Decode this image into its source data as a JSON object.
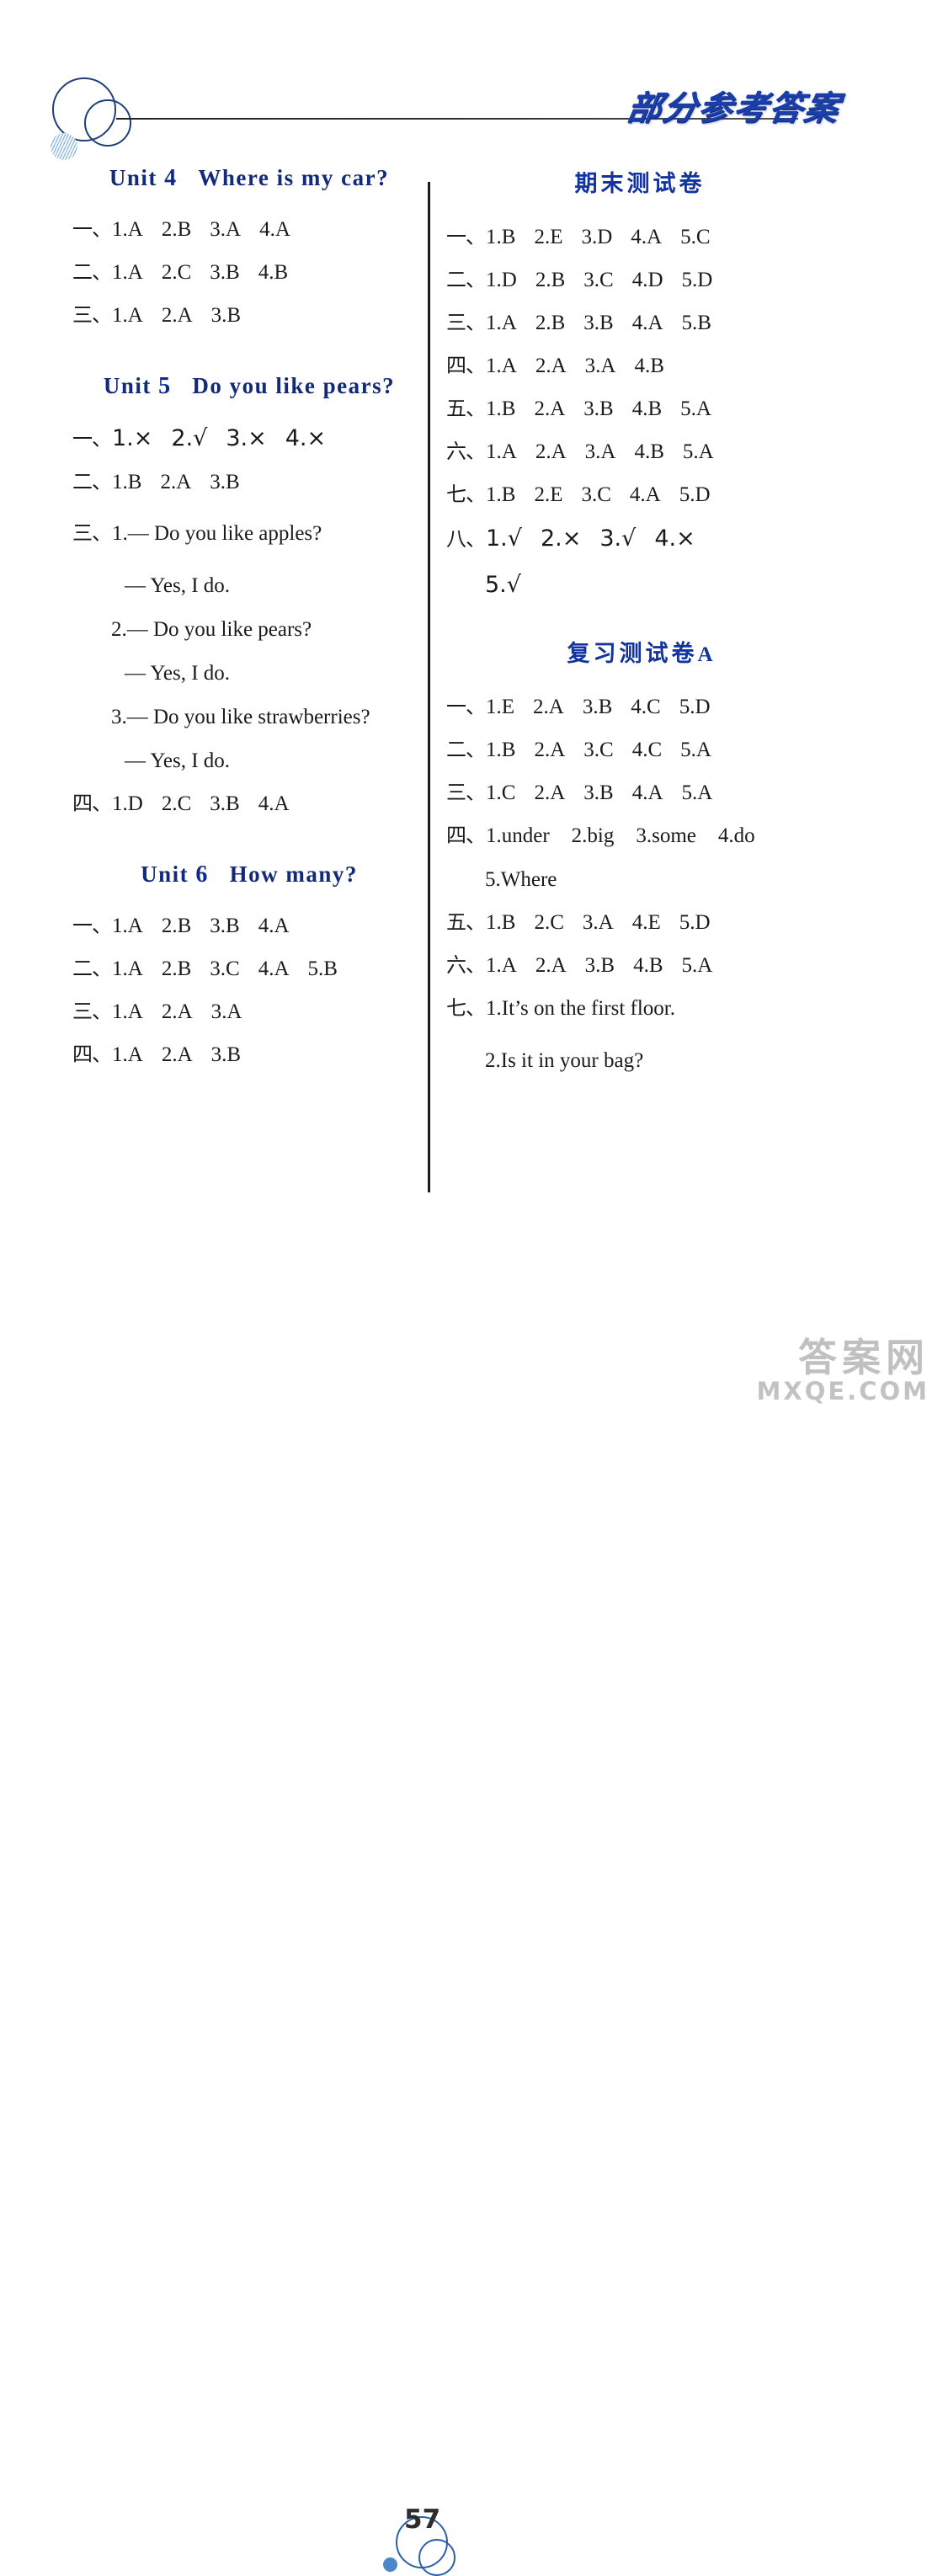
{
  "header": {
    "title": "部分参考答案"
  },
  "footer": {
    "page_number": "57",
    "watermark_cn": "答案网",
    "watermark_en": "MXQE.COM"
  },
  "left_column": {
    "unit4": {
      "label": "Unit",
      "number": "4",
      "title": "Where is my car?",
      "rows": [
        {
          "num": "一、",
          "answers": [
            "1.A",
            "2.B",
            "3.A",
            "4.A"
          ]
        },
        {
          "num": "二、",
          "answers": [
            "1.A",
            "2.C",
            "3.B",
            "4.B"
          ]
        },
        {
          "num": "三、",
          "answers": [
            "1.A",
            "2.A",
            "3.B"
          ]
        }
      ]
    },
    "unit5": {
      "label": "Unit",
      "number": "5",
      "title": "Do you like pears?",
      "rows": [
        {
          "num": "一、",
          "answers": [
            "1.×",
            "2.√",
            "3.×",
            "4.×"
          ]
        },
        {
          "num": "二、",
          "answers": [
            "1.B",
            "2.A",
            "3.B"
          ]
        }
      ],
      "dialogue_num": "三、",
      "dialogue": [
        {
          "q": "1.— Do you like apples?",
          "a": "— Yes, I do."
        },
        {
          "q": "2.— Do you like pears?",
          "a": "— Yes, I do."
        },
        {
          "q": "3.— Do you like strawberries?",
          "a": "— Yes, I do."
        }
      ],
      "last_row": {
        "num": "四、",
        "answers": [
          "1.D",
          "2.C",
          "3.B",
          "4.A"
        ]
      }
    },
    "unit6": {
      "label": "Unit",
      "number": "6",
      "title": "How many?",
      "rows": [
        {
          "num": "一、",
          "answers": [
            "1.A",
            "2.B",
            "3.B",
            "4.A"
          ]
        },
        {
          "num": "二、",
          "answers": [
            "1.A",
            "2.B",
            "3.C",
            "4.A",
            "5.B"
          ]
        },
        {
          "num": "三、",
          "answers": [
            "1.A",
            "2.A",
            "3.A"
          ]
        },
        {
          "num": "四、",
          "answers": [
            "1.A",
            "2.A",
            "3.B"
          ]
        }
      ]
    }
  },
  "right_column": {
    "final_exam": {
      "title": "期末测试卷",
      "rows": [
        {
          "num": "一、",
          "answers": [
            "1.B",
            "2.E",
            "3.D",
            "4.A",
            "5.C"
          ]
        },
        {
          "num": "二、",
          "answers": [
            "1.D",
            "2.B",
            "3.C",
            "4.D",
            "5.D"
          ]
        },
        {
          "num": "三、",
          "answers": [
            "1.A",
            "2.B",
            "3.B",
            "4.A",
            "5.B"
          ]
        },
        {
          "num": "四、",
          "answers": [
            "1.A",
            "2.A",
            "3.A",
            "4.B"
          ]
        },
        {
          "num": "五、",
          "answers": [
            "1.B",
            "2.A",
            "3.B",
            "4.B",
            "5.A"
          ]
        },
        {
          "num": "六、",
          "answers": [
            "1.A",
            "2.A",
            "3.A",
            "4.B",
            "5.A"
          ]
        },
        {
          "num": "七、",
          "answers": [
            "1.B",
            "2.E",
            "3.C",
            "4.A",
            "5.D"
          ]
        },
        {
          "num": "八、",
          "answers": [
            "1.√",
            "2.×",
            "3.√",
            "4.×"
          ]
        }
      ],
      "overflow_row": "5.√"
    },
    "review_a": {
      "title": "复习测试卷",
      "title_suffix": "A",
      "rows": [
        {
          "num": "一、",
          "answers": [
            "1.E",
            "2.A",
            "3.B",
            "4.C",
            "5.D"
          ]
        },
        {
          "num": "二、",
          "answers": [
            "1.B",
            "2.A",
            "3.C",
            "4.C",
            "5.A"
          ]
        },
        {
          "num": "三、",
          "answers": [
            "1.C",
            "2.A",
            "3.B",
            "4.A",
            "5.A"
          ]
        },
        {
          "num": "四、",
          "answers": [
            "1.under",
            "2.big",
            "3.some",
            "4.do"
          ]
        }
      ],
      "overflow_row": "5.Where",
      "rows2": [
        {
          "num": "五、",
          "answers": [
            "1.B",
            "2.C",
            "3.A",
            "4.E",
            "5.D"
          ]
        },
        {
          "num": "六、",
          "answers": [
            "1.A",
            "2.A",
            "3.B",
            "4.B",
            "5.A"
          ]
        }
      ],
      "sentences_num": "七、",
      "sentences": [
        "1.It’s on the first floor.",
        "2.Is it in your bag?"
      ]
    }
  }
}
